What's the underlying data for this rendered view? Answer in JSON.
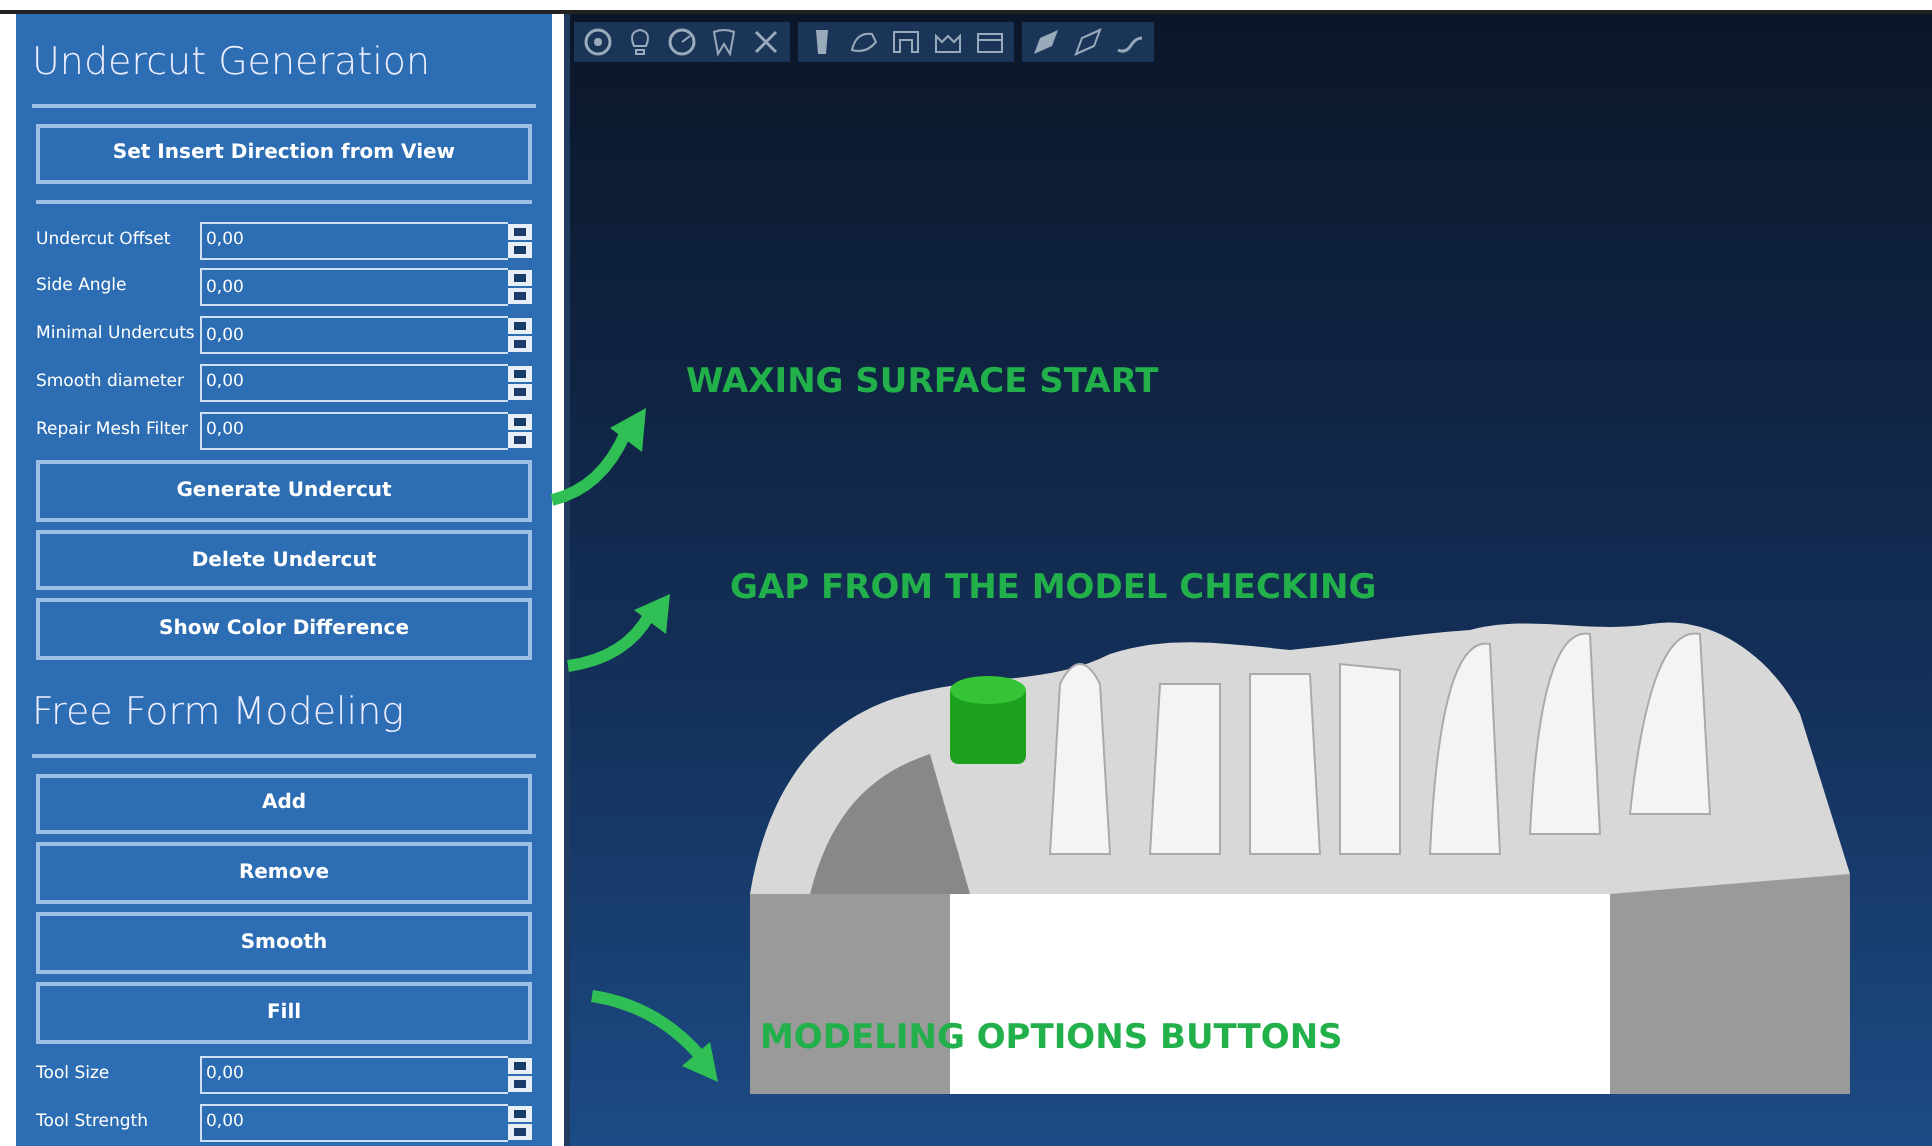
{
  "undercut_panel": {
    "title": "Undercut Generation",
    "insert_button": "Set Insert Direction from View",
    "fields": [
      {
        "label": "Undercut Offset",
        "value": "0,00"
      },
      {
        "label": "Side Angle",
        "value": "0,00"
      },
      {
        "label": "Minimal Undercuts",
        "value": "0,00"
      },
      {
        "label": "Smooth diameter",
        "value": "0,00"
      },
      {
        "label": "Repair Mesh Filter",
        "value": "0,00"
      }
    ],
    "buttons": [
      "Generate Undercut",
      "Delete Undercut",
      "Show Color Difference"
    ]
  },
  "modeling_panel": {
    "title": "Free Form Modeling",
    "buttons": [
      "Add",
      "Remove",
      "Smooth",
      "Fill"
    ],
    "fields": [
      {
        "label": "Tool Size",
        "value": "0,00"
      },
      {
        "label": "Tool Strength",
        "value": "0,00"
      }
    ]
  },
  "annotations": [
    {
      "text": "WAXING SURFACE START"
    },
    {
      "text": "GAP FROM THE MODEL CHECKING"
    },
    {
      "text": "MODELING OPTIONS  BUTTONS"
    }
  ]
}
